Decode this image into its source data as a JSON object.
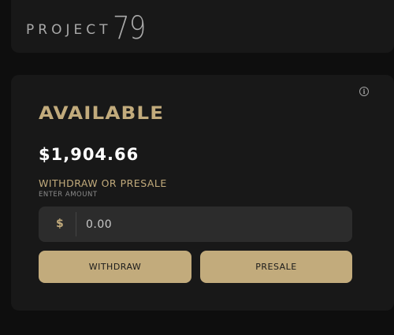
{
  "header": {
    "logo_text": "PROJECT",
    "logo_number": "79"
  },
  "wallet": {
    "info_icon": "info-icon",
    "title": "AVAILABLE",
    "balance": "$1,904.66",
    "section_label": "WITHDRAW OR PRESALE",
    "amount_label": "ENTER AMOUNT",
    "currency_symbol": "$",
    "amount_placeholder": "0.00",
    "withdraw_label": "WITHDRAW",
    "presale_label": "PRESALE"
  },
  "colors": {
    "background": "#0e0e0e",
    "card": "#181818",
    "accent_gold": "#c2ab7c",
    "input_bg": "#2c2c2c",
    "text_white": "#ffffff",
    "logo_gray": "#a9a9a9"
  }
}
